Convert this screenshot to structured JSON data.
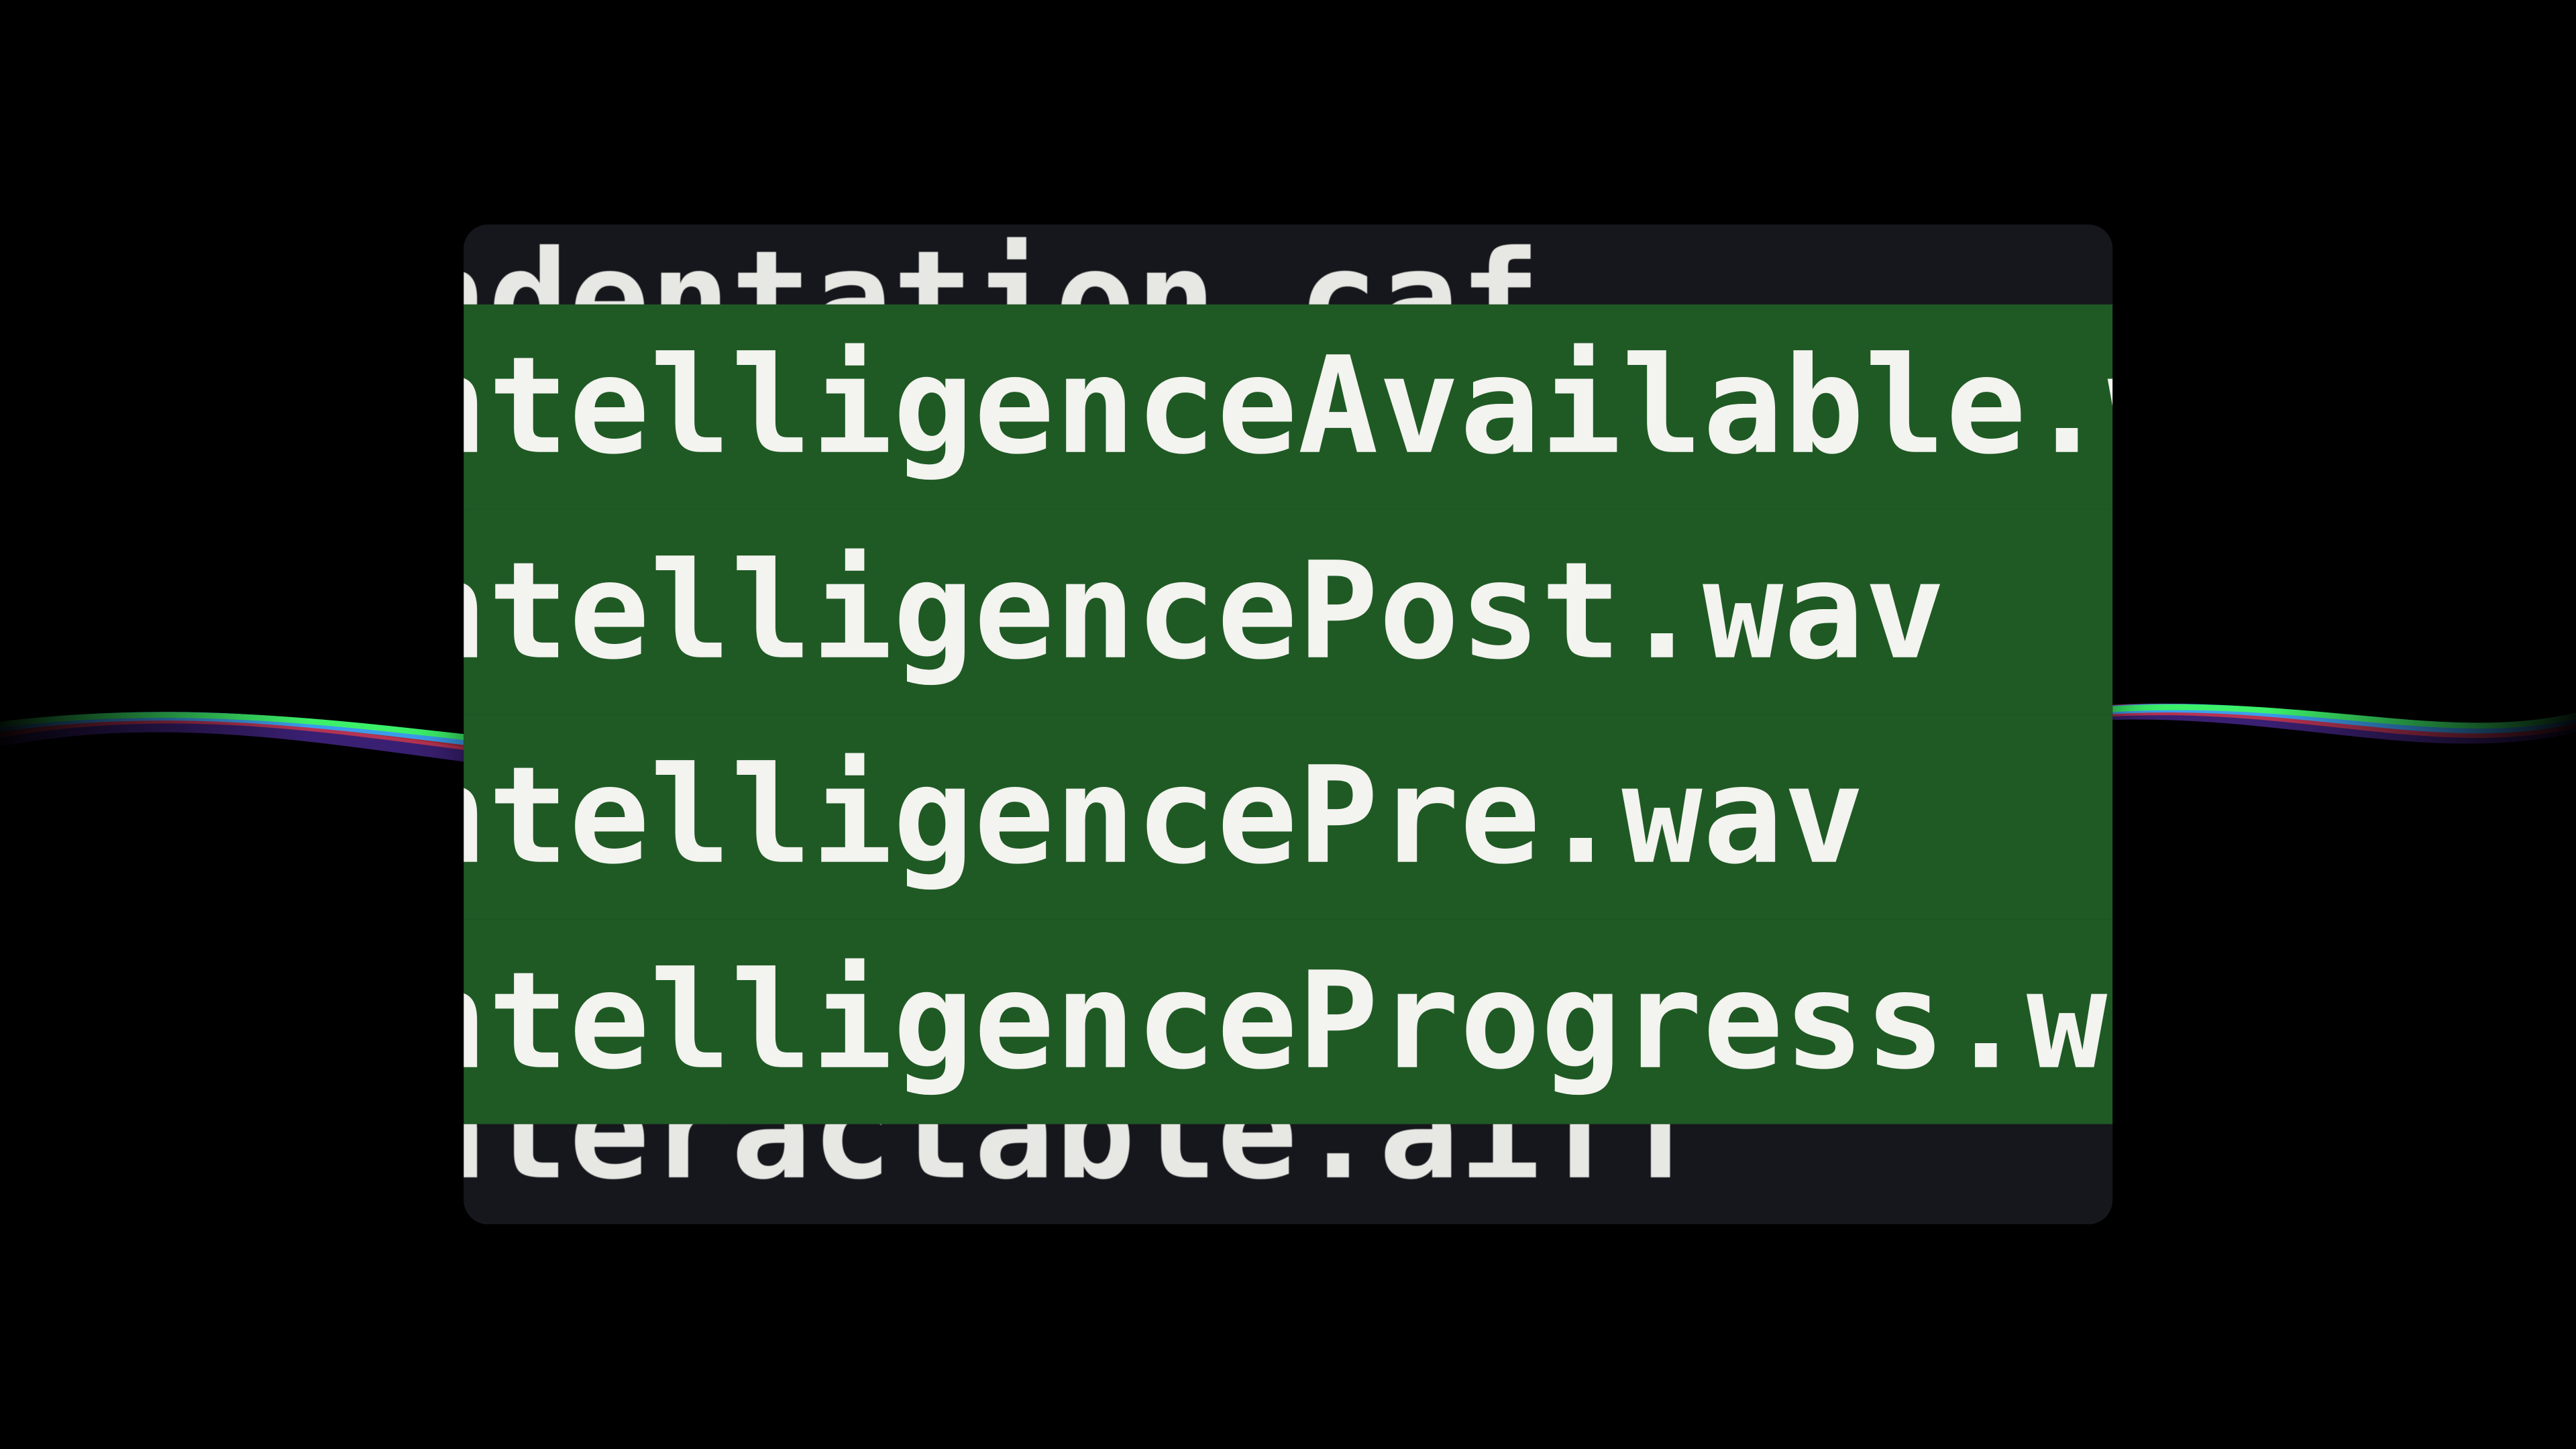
{
  "colors": {
    "panel_bg": "#16171c",
    "selection_bg": "#1f5a24",
    "text": "#f3f3ef",
    "wave_red": "#e03a4a",
    "wave_green": "#3cf06a",
    "wave_blue": "#2fa8ff",
    "wave_purple": "#6a3bd0"
  },
  "files": {
    "above_partial": "ndentation.caf",
    "selected": [
      "ntelligenceAvailable.wav",
      "ntelligencePost.wav",
      "ntelligencePre.wav",
      "ntelligenceProgress.wav"
    ],
    "below_partial": "nteractable.aiff"
  }
}
